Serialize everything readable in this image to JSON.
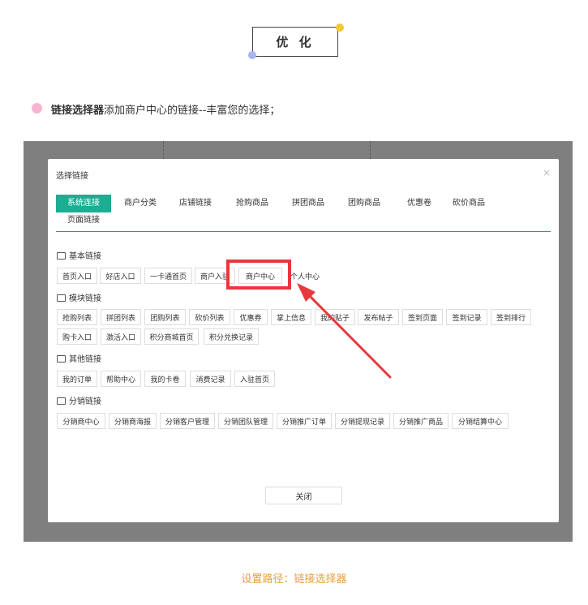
{
  "header": {
    "title": "优 化"
  },
  "intro": {
    "bold": "链接选择器",
    "text": "添加商户中心的链接--丰富您的选择；"
  },
  "modal": {
    "title": "选择链接",
    "close_icon": "×",
    "tabs": [
      "系统连接",
      "商户分类",
      "店铺链接",
      "抢购商品",
      "拼团商品",
      "团购商品",
      "优惠卷",
      "砍价商品",
      "页面链接"
    ],
    "sections": {
      "basic": {
        "title": "基本链接",
        "items": [
          "首页入口",
          "好店入口",
          "一卡通首页",
          "商户入驻",
          "商户中心",
          "个人中心"
        ]
      },
      "module": {
        "title": "模块链接",
        "items": [
          "抢购列表",
          "拼团列表",
          "团购列表",
          "砍价列表",
          "优惠券",
          "掌上信息",
          "我的贴子",
          "发布帖子",
          "签到页面",
          "签到记录",
          "签到排行",
          "购卡入口",
          "激活入口",
          "积分商城首页",
          "积分兑换记录"
        ]
      },
      "other": {
        "title": "其他链接",
        "items": [
          "我的订单",
          "帮助中心",
          "我的卡卷",
          "消费记录",
          "入驻首页"
        ]
      },
      "dist": {
        "title": "分销链接",
        "items": [
          "分销商中心",
          "分销商海报",
          "分销客户管理",
          "分销团队管理",
          "分销推广订单",
          "分销提现记录",
          "分销推广商品",
          "分销结算中心"
        ]
      }
    },
    "close_button": "关闭"
  },
  "caption": "设置路径：链接选择器",
  "colors": {
    "accent": "#1aae92",
    "highlight": "#e8383d",
    "caption": "#e6a03c"
  }
}
